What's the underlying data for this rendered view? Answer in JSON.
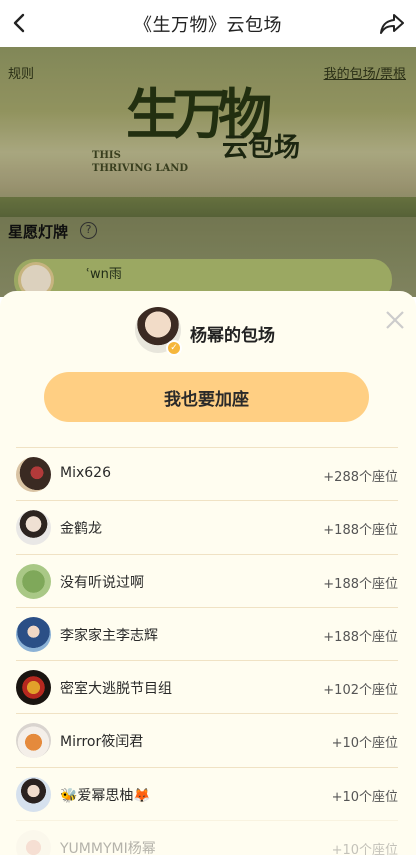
{
  "topbar": {
    "title": "《生万物》云包场",
    "back_icon": "back-chevron-icon",
    "share_icon": "share-arrow-icon"
  },
  "banner": {
    "rule_link": "规则",
    "ticket_link": "我的包场/票根",
    "logo_cn": "生万物",
    "logo_en_line1": "THIS",
    "logo_en_line2": "THRIVING LAND",
    "title": "云包场"
  },
  "wish_section": {
    "heading": "星愿灯牌",
    "help": "?",
    "card_name": "ʿwn雨"
  },
  "sheet": {
    "close_icon": "close-x-icon",
    "host_title": "杨幂的包场",
    "badge": "✓",
    "join_button": "我也要加座",
    "entries": [
      {
        "name": "Mix626",
        "seats": "+288个座位"
      },
      {
        "name": "金鹤龙",
        "seats": "+188个座位"
      },
      {
        "name": "没有听说过啊",
        "seats": "+188个座位"
      },
      {
        "name": "李家家主李志辉",
        "seats": "+188个座位"
      },
      {
        "name": "密室大逃脱节目组",
        "seats": "+102个座位"
      },
      {
        "name": "Mirror筱闰君",
        "seats": "+10个座位"
      },
      {
        "name": "🐝爱幂思柚🦊",
        "seats": "+10个座位"
      },
      {
        "name": "YUMMYMI杨幂",
        "seats": "+10个座位"
      }
    ]
  },
  "colors": {
    "accent": "#ffcf83",
    "sheet_bg": "#fffdf0",
    "banner_green": "#9ea067"
  }
}
